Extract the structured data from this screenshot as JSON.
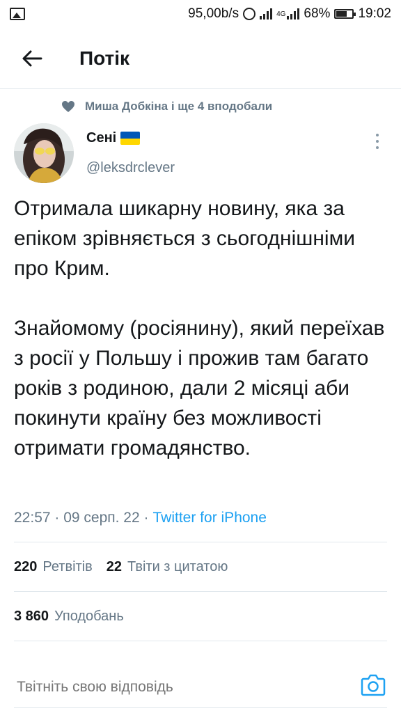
{
  "status_bar": {
    "speed": "95,00b/s",
    "network_label": "4G",
    "battery": "68%",
    "time": "19:02"
  },
  "header": {
    "title": "Потік"
  },
  "tweet": {
    "social_context": "Миша Добкіна і ще 4 вподобали",
    "author_name": "Сені",
    "author_handle": "@leksdrclever",
    "paragraph_1": "Отримала шикарну новину, яка за епіком зрівняється з сьогоднішніми про Крим.",
    "paragraph_2": "Знайомому (росіянину), який переїхав з росії у Польшу і прожив там багато років з родиною, дали 2 місяці аби покинути країну без можливості отримати громадянство.",
    "timestamp": "22:57 · 09 серп. 22 ·",
    "source": "Twitter for iPhone"
  },
  "stats": {
    "retweets_count": "220",
    "retweets_label": "Ретвітів",
    "quotes_count": "22",
    "quotes_label": "Твіти з цитатою",
    "likes_count": "3 860",
    "likes_label": "Уподобань"
  },
  "reply": {
    "placeholder": "Твітніть свою відповідь"
  },
  "colors": {
    "accent": "#1da1f2",
    "secondary_text": "#657786",
    "divider": "#e1e8ed"
  }
}
